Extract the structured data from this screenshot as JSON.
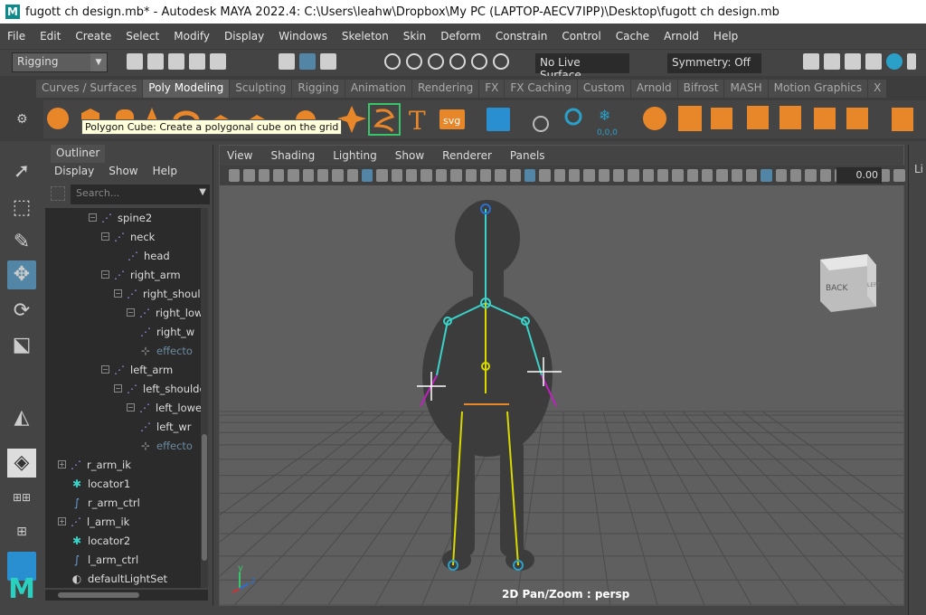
{
  "window": {
    "title": "fugott ch design.mb* - Autodesk MAYA 2022.4: C:\\Users\\leahw\\Dropbox\\My PC (LAPTOP-AECV7IPP)\\Desktop\\fugott ch design.mb",
    "logo_letter": "M"
  },
  "menubar": [
    "File",
    "Edit",
    "Create",
    "Select",
    "Modify",
    "Display",
    "Windows",
    "Skeleton",
    "Skin",
    "Deform",
    "Constrain",
    "Control",
    "Cache",
    "Arnold",
    "Help"
  ],
  "statusline": {
    "mode": "Rigging",
    "live_surface": "No Live Surface",
    "symmetry": "Symmetry: Off"
  },
  "shelf": {
    "tabs": [
      "Curves / Surfaces",
      "Poly Modeling",
      "Sculpting",
      "Rigging",
      "Animation",
      "Rendering",
      "FX",
      "FX Caching",
      "Custom",
      "Arnold",
      "Bifrost",
      "MASH",
      "Motion Graphics",
      "X"
    ],
    "active_tab": "Poly Modeling",
    "tooltip": "Polygon Cube: Create a polygonal cube on the grid",
    "svg_label": "svg",
    "t_label": "T",
    "num_label": "0,0,0"
  },
  "outliner": {
    "title": "Outliner",
    "menu": [
      "Display",
      "Show",
      "Help"
    ],
    "search_placeholder": "Search...",
    "items": [
      {
        "label": "spine2",
        "type": "joint",
        "dim": false
      },
      {
        "label": "neck",
        "type": "joint",
        "dim": false
      },
      {
        "label": "head",
        "type": "joint",
        "dim": false
      },
      {
        "label": "right_arm",
        "type": "joint",
        "dim": false
      },
      {
        "label": "right_shoulde",
        "type": "joint",
        "dim": false
      },
      {
        "label": "right_low",
        "type": "joint",
        "dim": false
      },
      {
        "label": "right_w",
        "type": "joint",
        "dim": false
      },
      {
        "label": "effecto",
        "type": "effector",
        "dim": true
      },
      {
        "label": "left_arm",
        "type": "joint",
        "dim": false
      },
      {
        "label": "left_shoulde",
        "type": "joint",
        "dim": false
      },
      {
        "label": "left_lower",
        "type": "joint",
        "dim": false
      },
      {
        "label": "left_wr",
        "type": "joint",
        "dim": false
      },
      {
        "label": "effecto",
        "type": "effector",
        "dim": true
      },
      {
        "label": "r_arm_ik",
        "type": "ik",
        "dim": false
      },
      {
        "label": "locator1",
        "type": "locator",
        "dim": false
      },
      {
        "label": "r_arm_ctrl",
        "type": "curve",
        "dim": false
      },
      {
        "label": "l_arm_ik",
        "type": "ik",
        "dim": false
      },
      {
        "label": "locator2",
        "type": "locator",
        "dim": false
      },
      {
        "label": "l_arm_ctrl",
        "type": "curve",
        "dim": false
      },
      {
        "label": "defaultLightSet",
        "type": "set",
        "dim": false
      }
    ]
  },
  "viewport": {
    "menu": [
      "View",
      "Shading",
      "Lighting",
      "Show",
      "Renderer",
      "Panels"
    ],
    "value_field": "0.00",
    "camera_label": "2D Pan/Zoom : persp",
    "viewcube_back": "BACK",
    "viewcube_left": "LEFT",
    "axis_y": "y",
    "axis_z": "z"
  },
  "right_panel": {
    "label": "Li"
  },
  "colors": {
    "accent": "#5285a6",
    "joint": "#a79bff",
    "skeleton_yellow": "#d9d900",
    "skeleton_cyan": "#3ad3c9",
    "ik_magenta": "#c020c0"
  }
}
